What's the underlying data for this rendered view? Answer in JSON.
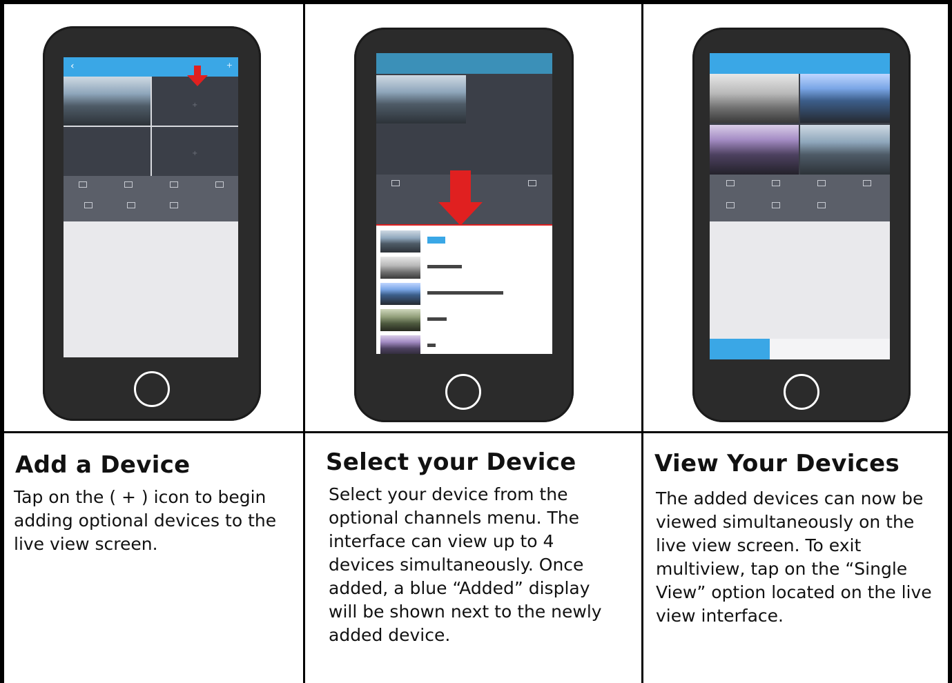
{
  "panels": [
    {
      "heading": "Add a Device",
      "body": "Tap on the ( + ) icon to begin adding optional devices to the live view screen."
    },
    {
      "heading": "Select your Device",
      "body": "Select your device from the optional channels menu. The interface can view up to 4 devices simultaneously. Once added, a blue “Added” display will be shown next to the newly added device."
    },
    {
      "heading": "View Your Devices",
      "body": "The added devices can now be viewed simultaneously on the live view screen. To exit multiview, tap on the “Single View” option located on the live view interface."
    }
  ],
  "colors": {
    "phone_body": "#2b2b2b",
    "app_bar": "#3aa7e6",
    "arrow": "#e02020",
    "live_view_bg": "#3b3f48",
    "toolbar": "#5b5f69"
  },
  "icons": [
    "back-arrow-icon",
    "plus-icon",
    "home-button-icon",
    "red-down-arrow-icon"
  ]
}
